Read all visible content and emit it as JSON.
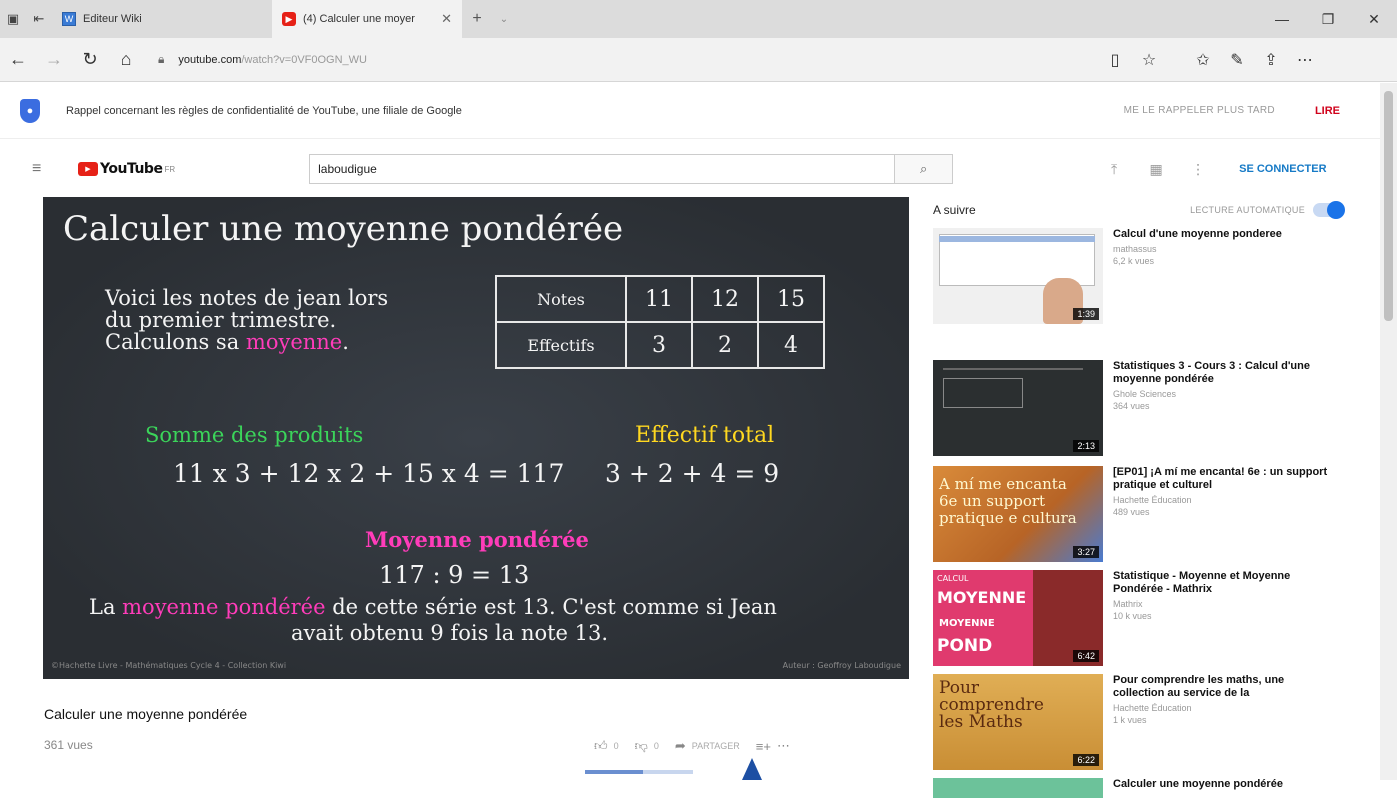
{
  "browser": {
    "tabs": [
      {
        "title": "Editeur Wiki"
      },
      {
        "title": "(4) Calculer une moyer"
      }
    ],
    "url_host": "youtube.com",
    "url_rest": "/watch?v=0VF0OGN_WU"
  },
  "notice": {
    "text": "Rappel concernant les règles de confidentialité de YouTube, une filiale de Google",
    "later": "ME LE RAPPELER PLUS TARD",
    "read": "LIRE"
  },
  "youtube": {
    "logo_text": "YouTube",
    "logo_suffix": "FR",
    "search_value": "laboudigue",
    "signin": "SE CONNECTER"
  },
  "video": {
    "title": "Calculer une moyenne pondérée",
    "intro_line1": "Voici les notes de jean lors",
    "intro_line2": "du premier trimestre.",
    "intro_line3_a": "Calculons sa ",
    "intro_line3_b": "moyenne",
    "intro_line3_c": ".",
    "table_header_notes": "Notes",
    "table_header_eff": "Effectifs",
    "notes": [
      "11",
      "12",
      "15"
    ],
    "effectifs": [
      "3",
      "2",
      "4"
    ],
    "sum_products_label": "Somme des produits",
    "sum_products_formula": "11 x 3 + 12 x 2 + 15 x 4 = 117",
    "eff_total_label": "Effectif total",
    "eff_total_formula": "3 + 2 + 4 = 9",
    "weighted_label": "Moyenne pondérée",
    "weighted_formula": "117 : 9 = 13",
    "conclusion_a": "La ",
    "conclusion_b": "moyenne pondérée",
    "conclusion_c": " de cette série est 13. C'est comme si Jean",
    "conclusion_line2": "avait obtenu 9 fois la note 13.",
    "footer_left": "©Hachette Livre - Mathématiques Cycle 4 - Collection Kiwi",
    "footer_right": "Auteur : Geoffroy Laboudigue"
  },
  "below": {
    "title": "Calculer une moyenne pondérée",
    "views": "361 vues",
    "likes": "0",
    "dislikes": "0",
    "share": "PARTAGER"
  },
  "sidebar": {
    "up_next": "A suivre",
    "autoplay": "LECTURE AUTOMATIQUE",
    "items": [
      {
        "title": "Calcul d'une moyenne ponderee",
        "channel": "mathassus",
        "views": "6,2 k vues",
        "duration": "1:39"
      },
      {
        "title": "Statistiques 3 - Cours 3 : Calcul d'une moyenne pondérée",
        "channel": "Ghole Sciences",
        "views": "364 vues",
        "duration": "2:13"
      },
      {
        "title": "[EP01] ¡A mí me encanta! 6e : un support pratique et culturel",
        "channel": "Hachette Éducation",
        "views": "489 vues",
        "duration": "3:27",
        "thumb_text": "A mí me encanta 6e un support pratique e cultura"
      },
      {
        "title": "Statistique - Moyenne et Moyenne Pondérée - Mathrix",
        "channel": "Mathrix",
        "views": "10 k vues",
        "duration": "6:42",
        "thumb_top": "CALCUL",
        "thumb_text1": "MOYENNE",
        "thumb_text2": "MOYENNE",
        "thumb_text3": "POND"
      },
      {
        "title": "Pour comprendre les maths, une collection au service de la",
        "channel": "Hachette Éducation",
        "views": "1 k vues",
        "duration": "6:22",
        "thumb_text": "Pour comprendre les Maths"
      }
    ],
    "partial_title": "Calculer une moyenne pondérée"
  }
}
